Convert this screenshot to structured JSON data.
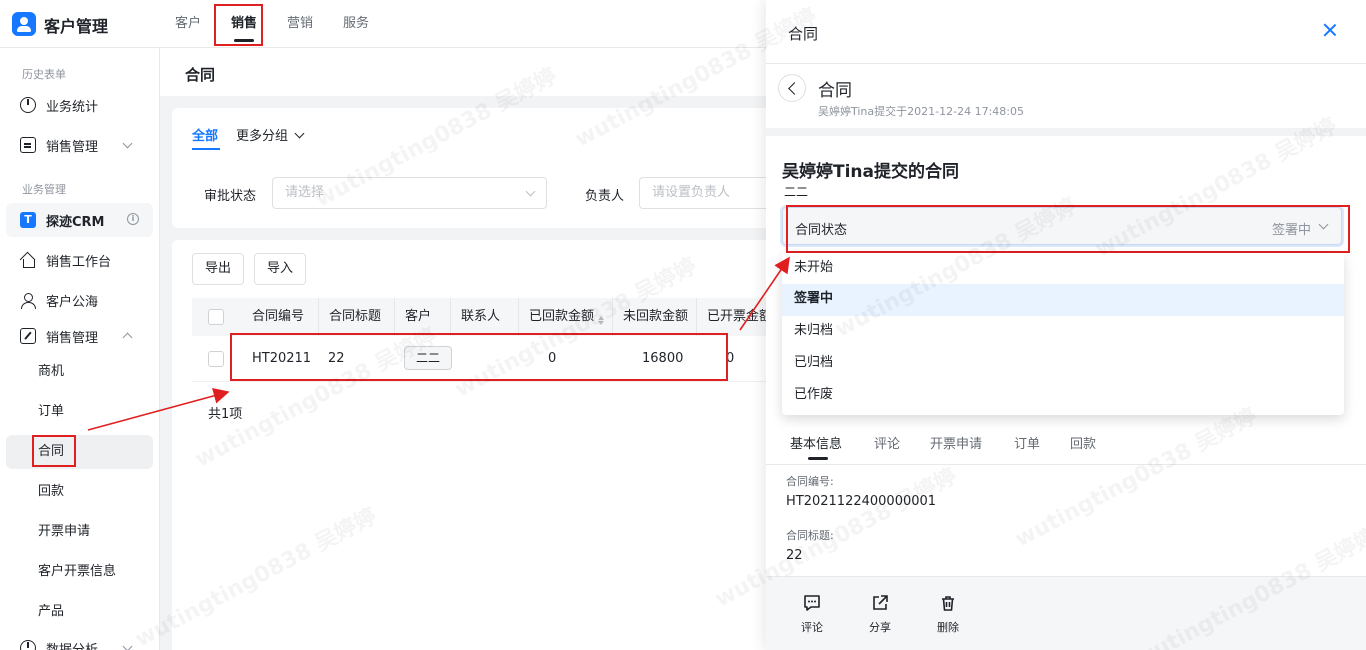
{
  "app": {
    "title": "客户管理"
  },
  "topnav": [
    {
      "label": "客户"
    },
    {
      "label": "销售"
    },
    {
      "label": "营销"
    },
    {
      "label": "服务"
    }
  ],
  "sidebar": {
    "section1": "历史表单",
    "section2": "业务管理",
    "items": {
      "business_stats": "业务统计",
      "sales_mgmt_1": "销售管理",
      "crm": "探迹CRM",
      "workbench": "销售工作台",
      "customer_pool": "客户公海",
      "sales_mgmt_2": "销售管理",
      "opportunity": "商机",
      "orders": "订单",
      "contract": "合同",
      "payment": "回款",
      "invoice_request": "开票申请",
      "customer_invoice": "客户开票信息",
      "product": "产品",
      "data_analysis": "数据分析"
    }
  },
  "main": {
    "page_title": "合同",
    "tabs": {
      "all": "全部",
      "more": "更多分组"
    },
    "filters": {
      "approval_label": "审批状态",
      "approval_placeholder": "请选择",
      "owner_label": "负责人",
      "owner_placeholder": "请设置负责人"
    },
    "buttons": {
      "export": "导出",
      "import": "导入"
    },
    "table": {
      "columns": [
        "合同编号",
        "合同标题",
        "客户",
        "联系人",
        "已回款金额",
        "未回款金额",
        "已开票金额"
      ],
      "rows": [
        {
          "id": "HT20211",
          "title": "22",
          "customer": "二二",
          "contact": "",
          "paid": "0",
          "unpaid": "16800",
          "invoiced": "0"
        }
      ],
      "total": "共1项"
    }
  },
  "drawer": {
    "title": "合同",
    "sub_title": "合同",
    "meta": "吴婷婷Tina提交于2021-12-24 17:48:05",
    "doc_title": "吴婷婷Tina提交的合同",
    "doc_sub": "二二",
    "status": {
      "label": "合同状态",
      "value": "签署中"
    },
    "options": [
      "未开始",
      "签署中",
      "未归档",
      "已归档",
      "已作废"
    ],
    "selected_option": "签署中",
    "tabs": [
      "基本信息",
      "评论",
      "开票申请",
      "订单",
      "回款"
    ],
    "fields": [
      {
        "label": "合同编号:",
        "value": "HT2021122400000001"
      },
      {
        "label": "合同标题:",
        "value": "22"
      }
    ],
    "actions": {
      "comment": "评论",
      "share": "分享",
      "delete": "删除"
    }
  },
  "watermark": "wutingting0838 吴婷婷",
  "colors": {
    "accent": "#1677ff",
    "highlight": "#e02020",
    "selected_bg": "#e8f3ff"
  }
}
